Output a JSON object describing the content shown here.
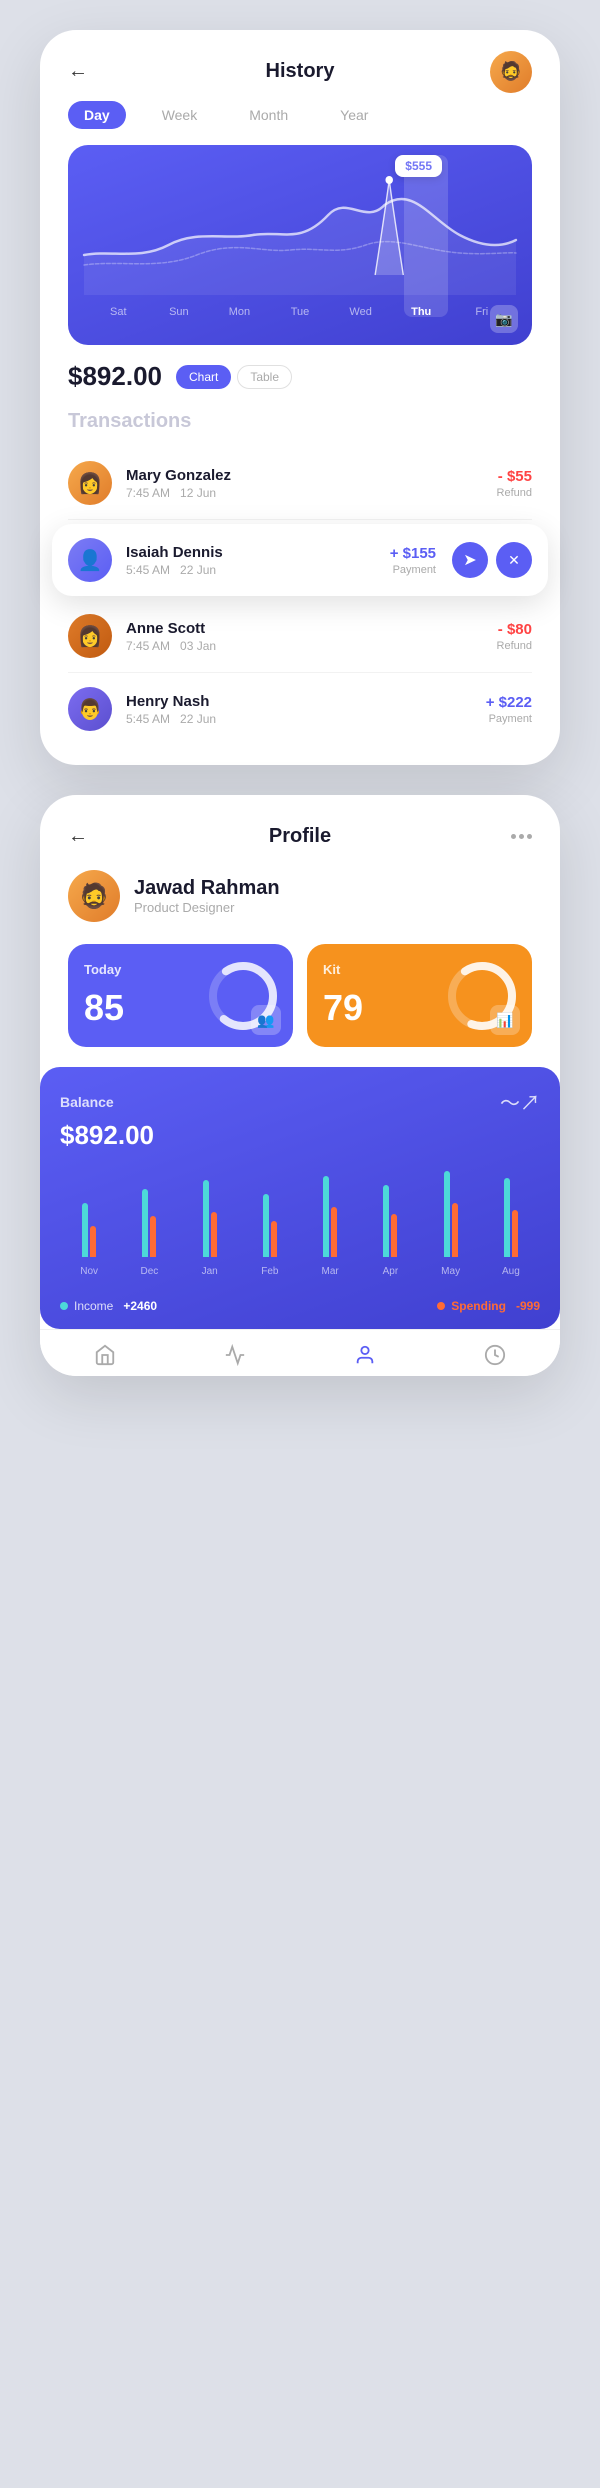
{
  "history": {
    "title": "History",
    "back_label": "←",
    "time_tabs": [
      "Day",
      "Week",
      "Month",
      "Year"
    ],
    "active_tab": "Day",
    "chart_tooltip": "$555",
    "chart_days": [
      "Sat",
      "Sun",
      "Mon",
      "Tue",
      "Wed",
      "Thu",
      "Fri"
    ],
    "active_day": "Thu",
    "balance": "$892.00",
    "view_tabs": [
      "Chart",
      "Table"
    ],
    "active_view": "Chart",
    "transactions_title": "Transactions",
    "transactions": [
      {
        "name": "Mary Gonzalez",
        "time": "7:45 AM",
        "date": "12 Jun",
        "amount": "- $55",
        "type": "Refund",
        "sign": "negative",
        "avatar_color": "#f6921e",
        "avatar_emoji": "👩"
      },
      {
        "name": "Isaiah Dennis",
        "time": "5:45 AM",
        "date": "22 Jun",
        "amount": "+ $155",
        "type": "Payment",
        "sign": "positive",
        "avatar_color": "#5b5ef4",
        "avatar_emoji": "👤",
        "expanded": true
      },
      {
        "name": "Anne Scott",
        "time": "7:45 AM",
        "date": "03 Jan",
        "amount": "- $80",
        "type": "Refund",
        "sign": "negative",
        "avatar_color": "#e07c2a",
        "avatar_emoji": "👩"
      },
      {
        "name": "Henry Nash",
        "time": "5:45 AM",
        "date": "22 Jun",
        "amount": "+ $222",
        "type": "Payment",
        "sign": "positive",
        "avatar_color": "#5b4fcf",
        "avatar_emoji": "👨"
      }
    ]
  },
  "profile": {
    "title": "Profile",
    "back_label": "←",
    "name": "Jawad Rahman",
    "role": "Product Designer",
    "stats": [
      {
        "label": "Today",
        "value": "85",
        "color": "blue"
      },
      {
        "label": "Kit",
        "value": "79",
        "color": "orange"
      }
    ],
    "balance_label": "Balance",
    "balance_amount": "$892.00",
    "bar_data": [
      {
        "month": "Nov",
        "income": 60,
        "spending": 35
      },
      {
        "month": "Dec",
        "income": 75,
        "spending": 45
      },
      {
        "month": "Jan",
        "income": 85,
        "spending": 50
      },
      {
        "month": "Feb",
        "income": 70,
        "spending": 40
      },
      {
        "month": "Mar",
        "income": 90,
        "spending": 55
      },
      {
        "month": "Apr",
        "income": 80,
        "spending": 48
      },
      {
        "month": "May",
        "income": 95,
        "spending": 60
      },
      {
        "month": "Aug",
        "income": 88,
        "spending": 52
      }
    ],
    "legend_income": "Income",
    "legend_income_value": "+2460",
    "legend_spending": "Spending",
    "legend_spending_value": "-999",
    "nav_items": [
      "home",
      "activity",
      "profile",
      "dollar"
    ]
  }
}
